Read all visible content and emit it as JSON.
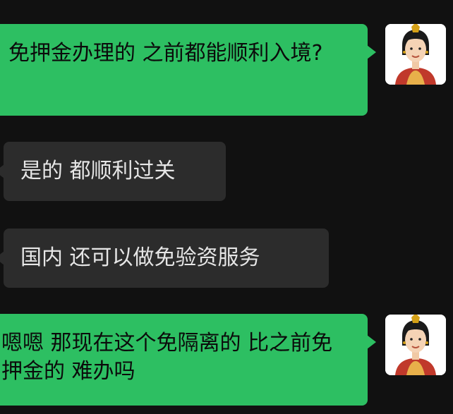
{
  "messages": [
    {
      "direction": "sent",
      "text": "免押金办理的 之前都能顺利入境?"
    },
    {
      "direction": "received",
      "text": "是的 都顺利过关"
    },
    {
      "direction": "received",
      "text": "国内 还可以做免验资服务"
    },
    {
      "direction": "sent",
      "text": "嗯嗯 那现在这个免隔离的 比之前免押金的 难办吗"
    }
  ],
  "avatar": {
    "icon": "user-avatar-icon"
  },
  "colors": {
    "background": "#111111",
    "sent_bubble": "#2dbf62",
    "received_bubble": "#2c2c2c"
  }
}
